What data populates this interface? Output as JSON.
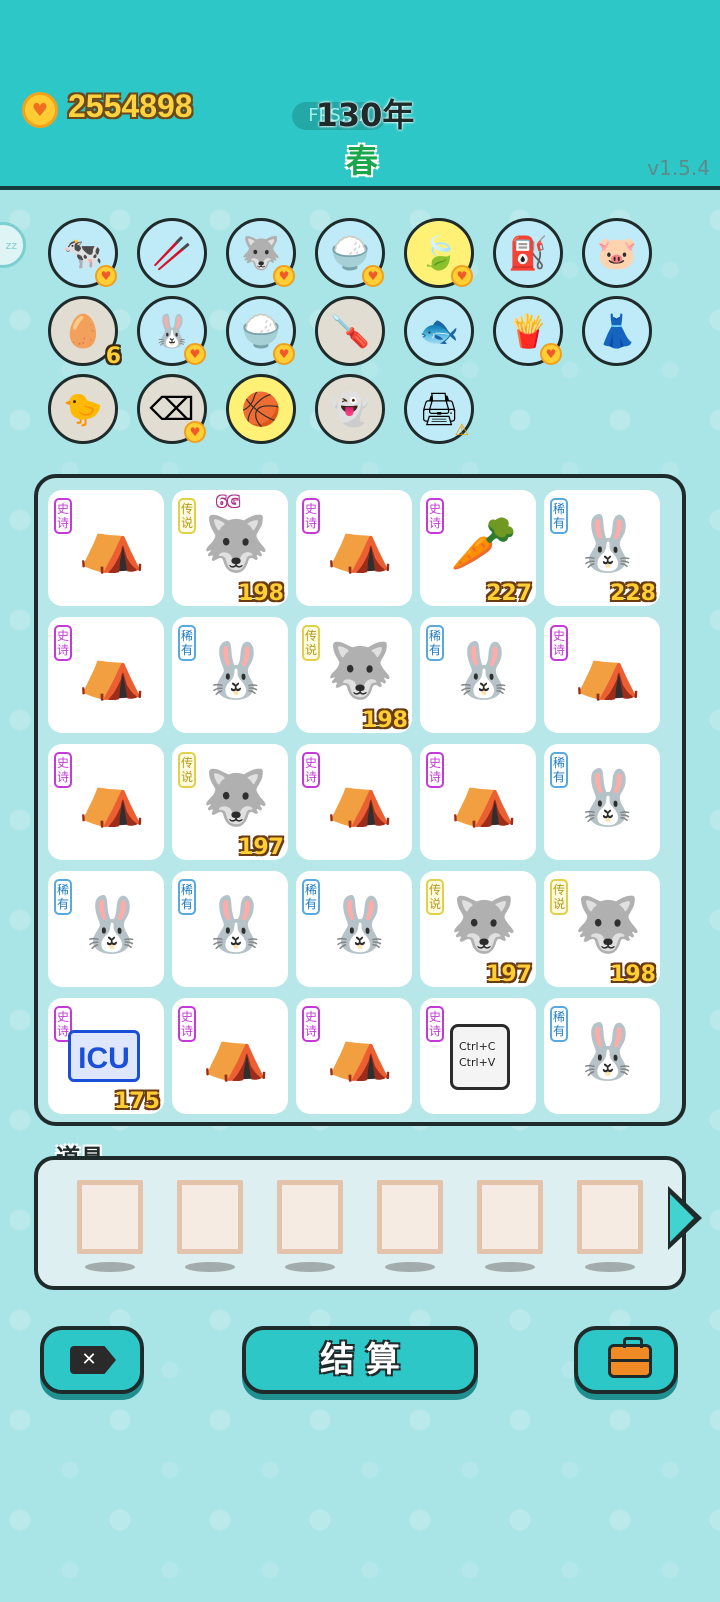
{
  "header": {
    "coins": "2554898",
    "fps": "FPS:32",
    "year": "130年",
    "season": "春",
    "version": "v1.5.4"
  },
  "colors": {
    "header_bg": "#2ec7c7",
    "page_bg": "#a9e4e6",
    "epic": "#c43ad6",
    "legend": "#e0d04a",
    "rare": "#57a9e0"
  },
  "relics": [
    {
      "name": "milk-cows-icon",
      "glyph": "🐄",
      "bg": "blue",
      "heart": true
    },
    {
      "name": "chopsticks-icon",
      "glyph": "🥢",
      "bg": "blue",
      "heart": false
    },
    {
      "name": "husky-icon",
      "glyph": "🐺",
      "bg": "blue",
      "heart": true
    },
    {
      "name": "rice-bowl-icon",
      "glyph": "🍚",
      "bg": "blue",
      "heart": true
    },
    {
      "name": "leaf-icon",
      "glyph": "🍃",
      "bg": "yellow",
      "heart": true
    },
    {
      "name": "pump-icon",
      "glyph": "⛽",
      "bg": "blue",
      "heart": false
    },
    {
      "name": "piggy-bank-icon",
      "glyph": "🐷",
      "bg": "blue",
      "heart": false
    },
    {
      "name": "egg-tray-icon",
      "glyph": "🥚",
      "bg": "grey",
      "count": "6"
    },
    {
      "name": "rabbit-icon",
      "glyph": "🐰",
      "bg": "blue",
      "heart": true
    },
    {
      "name": "rice-bowl-icon",
      "glyph": "🍚",
      "bg": "blue",
      "heart": true
    },
    {
      "name": "screwdriver-icon",
      "glyph": "🪛",
      "bg": "grey",
      "heart": false
    },
    {
      "name": "fish-tank-icon",
      "glyph": "🐟",
      "bg": "blue",
      "heart": false
    },
    {
      "name": "fries-icon",
      "glyph": "🍟",
      "bg": "blue",
      "heart": true
    },
    {
      "name": "skirt-icon",
      "glyph": "👗",
      "bg": "blue",
      "heart": false
    },
    {
      "name": "chick-egg-icon",
      "glyph": "🐤",
      "bg": "grey",
      "heart": false
    },
    {
      "name": "delete-tag-icon",
      "glyph": "⌫",
      "bg": "grey",
      "heart": true
    },
    {
      "name": "basketballs-icon",
      "glyph": "🏀",
      "bg": "yellow",
      "heart": false
    },
    {
      "name": "ghost-icon",
      "glyph": "👻",
      "bg": "grey",
      "heart": false
    },
    {
      "name": "printer-icon",
      "glyph": "🖨",
      "bg": "blue",
      "warn": true
    }
  ],
  "board": [
    [
      {
        "rarity": "史诗",
        "type": "epic",
        "sym": "⛺",
        "name": "rabbit-tent-icon"
      },
      {
        "rarity": "传说",
        "type": "legend",
        "sym": "🐺",
        "name": "husky-king-icon",
        "num": "198",
        "top": "6G"
      },
      {
        "rarity": "史诗",
        "type": "epic",
        "sym": "⛺",
        "name": "rabbit-tent-icon"
      },
      {
        "rarity": "史诗",
        "type": "epic",
        "sym": "🥕",
        "name": "carrot-icon",
        "num": "227"
      },
      {
        "rarity": "稀有",
        "type": "rare",
        "sym": "🐰",
        "name": "rabbit-icon",
        "num": "228"
      }
    ],
    [
      {
        "rarity": "史诗",
        "type": "epic",
        "sym": "⛺",
        "name": "rabbit-tent-icon"
      },
      {
        "rarity": "稀有",
        "type": "rare",
        "sym": "🐰",
        "name": "rabbit-icon"
      },
      {
        "rarity": "传说",
        "type": "legend",
        "sym": "🐺",
        "name": "husky-king-icon",
        "num": "198"
      },
      {
        "rarity": "稀有",
        "type": "rare",
        "sym": "🐰",
        "name": "rabbit-icon"
      },
      {
        "rarity": "史诗",
        "type": "epic",
        "sym": "⛺",
        "name": "rabbit-tent-icon"
      }
    ],
    [
      {
        "rarity": "史诗",
        "type": "epic",
        "sym": "⛺",
        "name": "rabbit-tent-icon"
      },
      {
        "rarity": "传说",
        "type": "legend",
        "sym": "🐺",
        "name": "husky-king-icon",
        "num": "197"
      },
      {
        "rarity": "史诗",
        "type": "epic",
        "sym": "⛺",
        "name": "rabbit-tent-icon"
      },
      {
        "rarity": "史诗",
        "type": "epic",
        "sym": "⛺",
        "name": "rabbit-tent-icon"
      },
      {
        "rarity": "稀有",
        "type": "rare",
        "sym": "🐰",
        "name": "rabbit-icon"
      }
    ],
    [
      {
        "rarity": "稀有",
        "type": "rare",
        "sym": "🐰",
        "name": "rabbit-icon"
      },
      {
        "rarity": "稀有",
        "type": "rare",
        "sym": "🐰",
        "name": "rabbit-icon"
      },
      {
        "rarity": "稀有",
        "type": "rare",
        "sym": "🐰",
        "name": "rabbit-icon"
      },
      {
        "rarity": "传说",
        "type": "legend",
        "sym": "🐺",
        "name": "husky-king-icon",
        "num": "197"
      },
      {
        "rarity": "传说",
        "type": "legend",
        "sym": "🐺",
        "name": "husky-king-icon",
        "num": "198"
      }
    ],
    [
      {
        "rarity": "史诗",
        "type": "epic",
        "sym": "ICU",
        "name": "icu-sign-icon",
        "num": "175"
      },
      {
        "rarity": "史诗",
        "type": "epic",
        "sym": "⛺",
        "name": "rabbit-tent-icon"
      },
      {
        "rarity": "史诗",
        "type": "epic",
        "sym": "⛺",
        "name": "rabbit-tent-icon"
      },
      {
        "rarity": "史诗",
        "type": "epic",
        "sym": "COPY",
        "name": "copy-paste-cards-icon",
        "lines": [
          "Ctrl+C",
          "Ctrl+V"
        ]
      },
      {
        "rarity": "稀有",
        "type": "rare",
        "sym": "🐰",
        "name": "rabbit-icon"
      }
    ]
  ],
  "items": {
    "label": "道具",
    "slots": 6
  },
  "buttons": {
    "delete": "✕",
    "settle": "结 算"
  }
}
